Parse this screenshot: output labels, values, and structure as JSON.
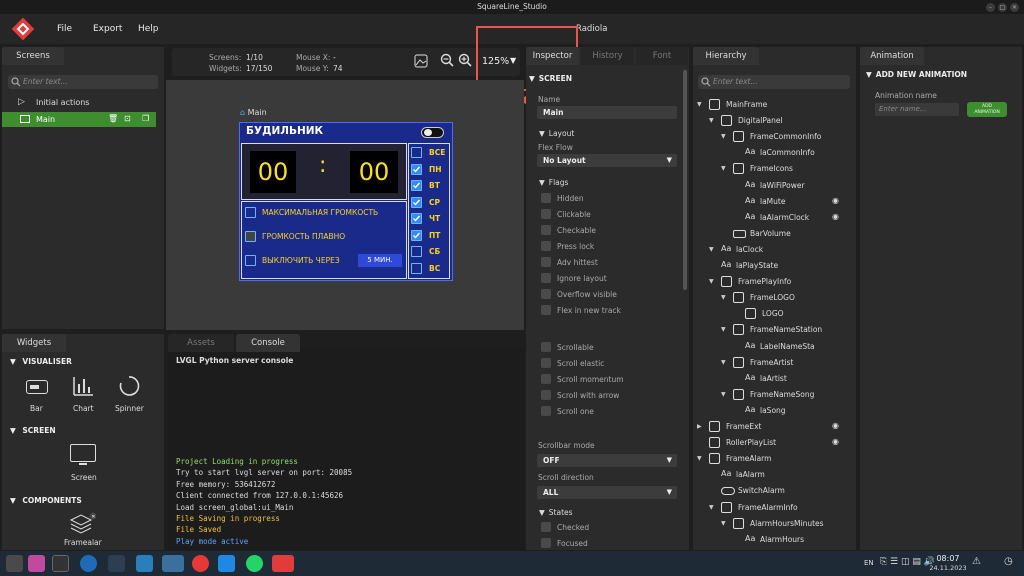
{
  "window": {
    "title": "SquareLine_Studio",
    "btn_min": "–",
    "btn_max": "□",
    "btn_close": "✕"
  },
  "menu": {
    "file": "File",
    "export": "Export",
    "help": "Help",
    "project": "Radiola"
  },
  "screens_panel": {
    "tab": "Screens",
    "search_placeholder": "Enter text...",
    "initial_actions": "Initial actions",
    "main": "Main"
  },
  "toolbar": {
    "screens_label": "Screens:",
    "screens_value": "1/10",
    "widgets_label": "Widgets:",
    "widgets_value": "17/150",
    "mousex_label": "Mouse X:",
    "mousex_value": "-",
    "mousey_label": "Mouse Y:",
    "mousey_value": "74",
    "zoom": "125%"
  },
  "canvas": {
    "screen_name": "Main",
    "title": "БУДИЛЬНИК",
    "hours": "00",
    "colon": ":",
    "minutes": "00",
    "opt1": "МАКСИМАЛЬНАЯ ГРОМКОСТЬ",
    "opt2": "ГРОМКОСТЬ ПЛАВНО",
    "opt3": "ВЫКЛЮЧИТЬ ЧЕРЕЗ",
    "minutes_btn": "5 МИН.",
    "days": [
      {
        "label": "ВСЕ",
        "checked": false
      },
      {
        "label": "ПН",
        "checked": true
      },
      {
        "label": "ВТ",
        "checked": true
      },
      {
        "label": "СР",
        "checked": true
      },
      {
        "label": "ЧТ",
        "checked": true
      },
      {
        "label": "ПТ",
        "checked": true
      },
      {
        "label": "СБ",
        "checked": false
      },
      {
        "label": "ВС",
        "checked": false
      }
    ]
  },
  "widgets_panel": {
    "tab": "Widgets",
    "visualiser": "VISUALISER",
    "bar": "Bar",
    "chart": "Chart",
    "spinner": "Spinner",
    "screen_section": "SCREEN",
    "screen": "Screen",
    "components": "COMPONENTS",
    "framealar": "Framealar"
  },
  "bottom_tabs": {
    "assets": "Assets",
    "console": "Console"
  },
  "console": {
    "header": "LVGL Python server console",
    "lines": [
      {
        "text": "Project Loading in progress",
        "color": "#8ee06b"
      },
      {
        "text": "Try to start lvgl server on port: 20085",
        "color": "#dddddd"
      },
      {
        "text": "Free memory: 536412672",
        "color": "#dddddd"
      },
      {
        "text": "Client connected from 127.0.0.1:45626",
        "color": "#dddddd"
      },
      {
        "text": "Load screen_global:ui_Main",
        "color": "#dddddd"
      },
      {
        "text": "File Saving in progress",
        "color": "#f0c23a"
      },
      {
        "text": "File Saved",
        "color": "#f0c23a"
      },
      {
        "text": "Play mode active",
        "color": "#57a6ff"
      }
    ]
  },
  "inspector": {
    "tabs": [
      "Inspector",
      "History",
      "Font"
    ],
    "screen_section": "SCREEN",
    "name_label": "Name",
    "name_value": "Main",
    "layout_section": "Layout",
    "flexflow_label": "Flex Flow",
    "flexflow_value": "No Layout",
    "flags_section": "Flags",
    "flags": [
      "Hidden",
      "Clickable",
      "Checkable",
      "Press lock",
      "Adv hittest",
      "Ignore layout",
      "Overflow visible",
      "Flex in new track"
    ],
    "scroll_flags": [
      "Scrollable",
      "Scroll elastic",
      "Scroll momentum",
      "Scroll with arrow",
      "Scroll one"
    ],
    "scrollbar_label": "Scrollbar mode",
    "scrollbar_value": "OFF",
    "scrolldir_label": "Scroll direction",
    "scrolldir_value": "ALL",
    "states_section": "States",
    "states": [
      "Checked",
      "Focused"
    ]
  },
  "hierarchy": {
    "tab": "Hierarchy",
    "search_placeholder": "Enter text...",
    "items": [
      {
        "label": "MainFrame",
        "icon": "frame"
      },
      {
        "label": "DigitalPanel",
        "icon": "frame"
      },
      {
        "label": "FrameCommonInfo",
        "icon": "frame"
      },
      {
        "label": "laCommonInfo",
        "icon": "text"
      },
      {
        "label": "FrameIcons",
        "icon": "frame"
      },
      {
        "label": "laWiFiPower",
        "icon": "text"
      },
      {
        "label": "laMute",
        "icon": "text"
      },
      {
        "label": "laAlarmClock",
        "icon": "text"
      },
      {
        "label": "BarVolume",
        "icon": "bar"
      },
      {
        "label": "laClock",
        "icon": "text"
      },
      {
        "label": "laPlayState",
        "icon": "text"
      },
      {
        "label": "FramePlayInfo",
        "icon": "frame"
      },
      {
        "label": "FrameLOGO",
        "icon": "frame"
      },
      {
        "label": "LOGO",
        "icon": "image"
      },
      {
        "label": "FrameNameStation",
        "icon": "frame"
      },
      {
        "label": "LabelNameSta",
        "icon": "text"
      },
      {
        "label": "FrameArtist",
        "icon": "frame"
      },
      {
        "label": "laArtist",
        "icon": "text"
      },
      {
        "label": "FrameNameSong",
        "icon": "frame"
      },
      {
        "label": "laSong",
        "icon": "text"
      },
      {
        "label": "FrameExt",
        "icon": "frame"
      },
      {
        "label": "RollerPlayList",
        "icon": "roller"
      },
      {
        "label": "FrameAlarm",
        "icon": "frame"
      },
      {
        "label": "laAlarm",
        "icon": "text"
      },
      {
        "label": "SwitchAlarm",
        "icon": "switch"
      },
      {
        "label": "FrameAlarmInfo",
        "icon": "frame"
      },
      {
        "label": "AlarmHoursMinutes",
        "icon": "frame"
      },
      {
        "label": "AlarmHours",
        "icon": "text"
      }
    ]
  },
  "animation": {
    "tab": "Animation",
    "add_section": "ADD NEW ANIMATION",
    "name_label": "Animation name",
    "name_placeholder": "Enter name...",
    "add_btn_line1": "ADD",
    "add_btn_line2": "ANIMATION"
  },
  "tray": {
    "lang": "EN",
    "time": "08:07",
    "date": "24.11.2023"
  },
  "colors": {
    "accent": "#2f8bff",
    "highlight_box": "#e8574a",
    "selected_screen": "#3e8e2f",
    "lcd_bg": "#1a2a8a"
  }
}
